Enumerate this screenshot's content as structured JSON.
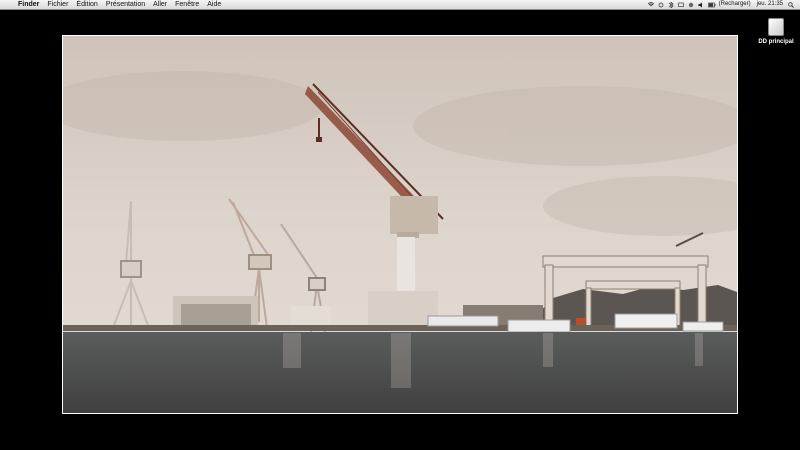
{
  "menubar": {
    "apple_icon": "apple-icon",
    "app_name": "Finder",
    "items": [
      "Fichier",
      "Édition",
      "Présentation",
      "Aller",
      "Fenêtre",
      "Aide"
    ],
    "status": {
      "charge_text": "(Recharger)",
      "clock": "jeu. 21:35"
    }
  },
  "desktop": {
    "drive_label": "DD principal"
  },
  "photo": {
    "subject": "shipyard cranes by the harbor"
  },
  "colors": {
    "sky": "#d9d0c8",
    "water": "#4d4d4b",
    "crane": "#c9bfb4"
  }
}
